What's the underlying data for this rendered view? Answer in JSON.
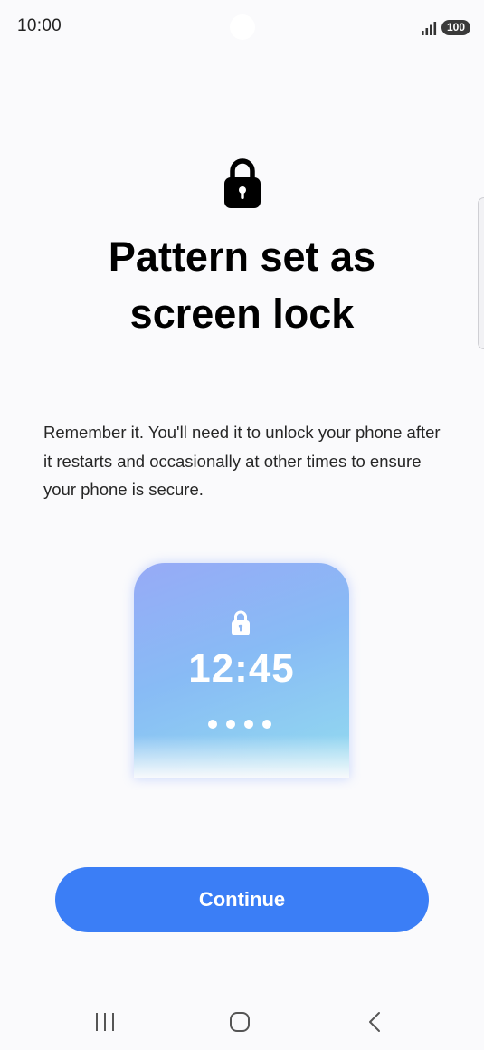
{
  "status_bar": {
    "time": "10:00",
    "battery": "100",
    "icons": [
      "signal-icon",
      "battery-icon"
    ]
  },
  "header": {
    "icon": "lock-icon",
    "title_line1": "Pattern set as",
    "title_line2": "screen lock"
  },
  "description": "Remember it. You'll need it to unlock your phone after it restarts and occasionally at other times to ensure your phone is secure.",
  "preview": {
    "icon": "lock-icon",
    "time": "12:45",
    "dots_count": 4
  },
  "actions": {
    "continue_label": "Continue"
  },
  "nav_bar": {
    "icons": [
      "recent-apps-icon",
      "home-icon",
      "back-icon"
    ]
  },
  "colors": {
    "accent": "#3b7ef6",
    "background": "#fafafc",
    "preview_gradient_start": "#97aaf6",
    "preview_gradient_end": "#93dcef"
  }
}
